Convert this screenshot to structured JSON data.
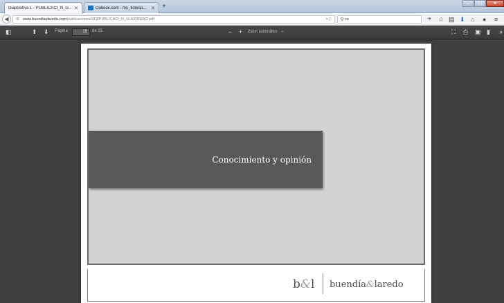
{
  "browser": {
    "tabs": [
      {
        "title": "Diapositiva 1 - PUBLICACI_N_G...",
        "active": true,
        "favicon_color": "#f2a33a"
      },
      {
        "title": "Outlook.com - mc_floresp...",
        "active": false,
        "favicon_color": "#1e73be"
      }
    ],
    "new_tab": "+",
    "window_controls": {
      "minimize": "–",
      "maximize": "□",
      "close": "✕"
    },
    "address": {
      "host": "www.buendiaylaredo.com",
      "path": "/publicaciones/319/PUBLICACI_N_GUERRERO.pdf",
      "reload": "▾ C"
    },
    "search": {
      "value": "Q oe"
    },
    "icons": [
      "arrow-right-icon",
      "star-icon",
      "clipboard-icon",
      "download-icon",
      "home-icon",
      "chat-icon",
      "menu-icon"
    ]
  },
  "pdf_toolbar": {
    "page_label": "Página:",
    "page_number": "19",
    "page_total": "de 25",
    "zoom_out": "–",
    "zoom_in": "+",
    "zoom_value": "Zoom automático",
    "zoom_caret": "÷"
  },
  "slide": {
    "title": "Conocimiento y opinión",
    "logo_short": {
      "b": "b",
      "amp": "&",
      "l": "l"
    },
    "logo_full": {
      "first": "buendía",
      "amp": "&",
      "second": "laredo"
    }
  }
}
